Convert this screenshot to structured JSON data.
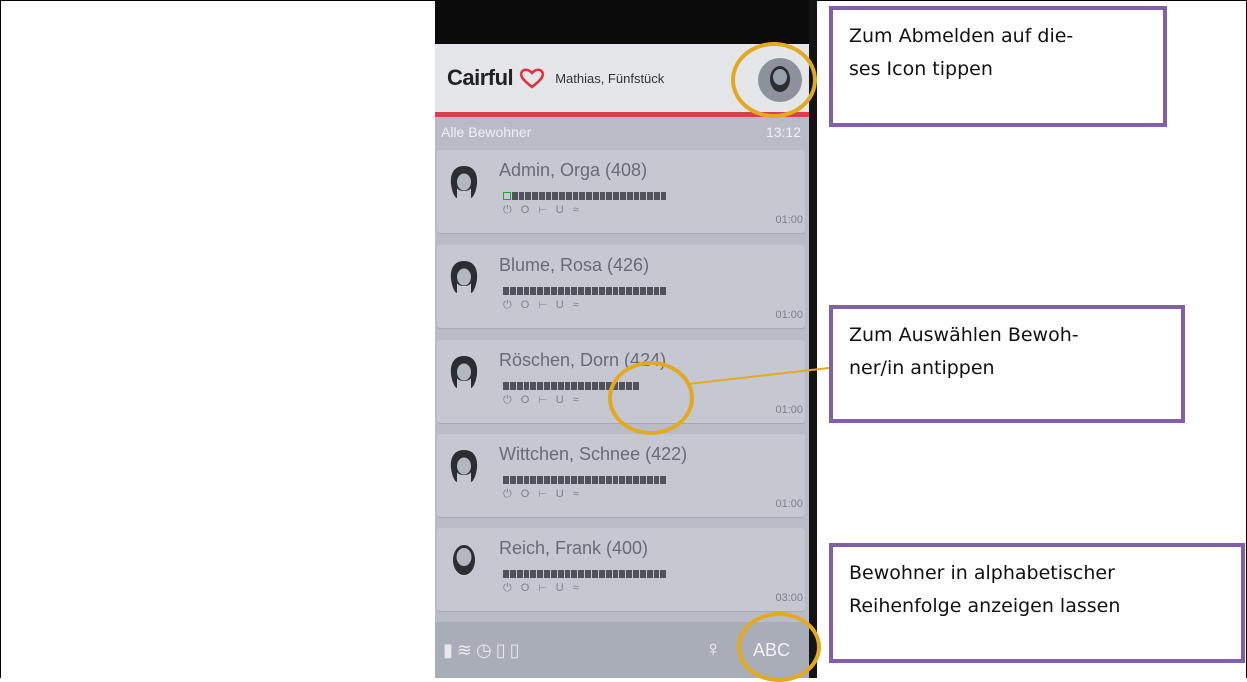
{
  "app": {
    "brand": "Cairful",
    "user_label": "Mathias, Fünfstück",
    "section_title": "Alle Bewohner",
    "clock": "13:12"
  },
  "residents": [
    {
      "name": "Admin, Orga (408)",
      "time": "01:00",
      "avatar": "female-avatar-icon"
    },
    {
      "name": "Blume, Rosa (426)",
      "time": "01:00",
      "avatar": "female-avatar-icon"
    },
    {
      "name": "Röschen, Dorn (424)",
      "time": "01:00",
      "avatar": "female-avatar-icon"
    },
    {
      "name": "Wittchen, Schnee (422)",
      "time": "01:00",
      "avatar": "female-avatar-icon"
    },
    {
      "name": "Reich, Frank (400)",
      "time": "03:00",
      "avatar": "male-avatar-icon"
    }
  ],
  "card_icons": "⏻ O ⊢ U ≈",
  "bottom_bar": {
    "sort_label": "ABC",
    "status_icons": [
      "battery-icon",
      "wifi-icon",
      "clock-icon",
      "signal-icon"
    ],
    "person_icon": "person-icon"
  },
  "callouts": {
    "logout_line1": "Zum Abmelden auf die-",
    "logout_line2": "ses Icon tippen",
    "select_line1": "Zum Auswählen Bewoh-",
    "select_line2": "ner/in antippen",
    "sort_line1": "Bewohner in alphabetischer",
    "sort_line2": "Reihenfolge anzeigen lassen"
  },
  "colors": {
    "highlight": "#e3a920",
    "callout_border": "#8060a8",
    "header_accent": "#d6414b",
    "heart": "#e0333e"
  }
}
